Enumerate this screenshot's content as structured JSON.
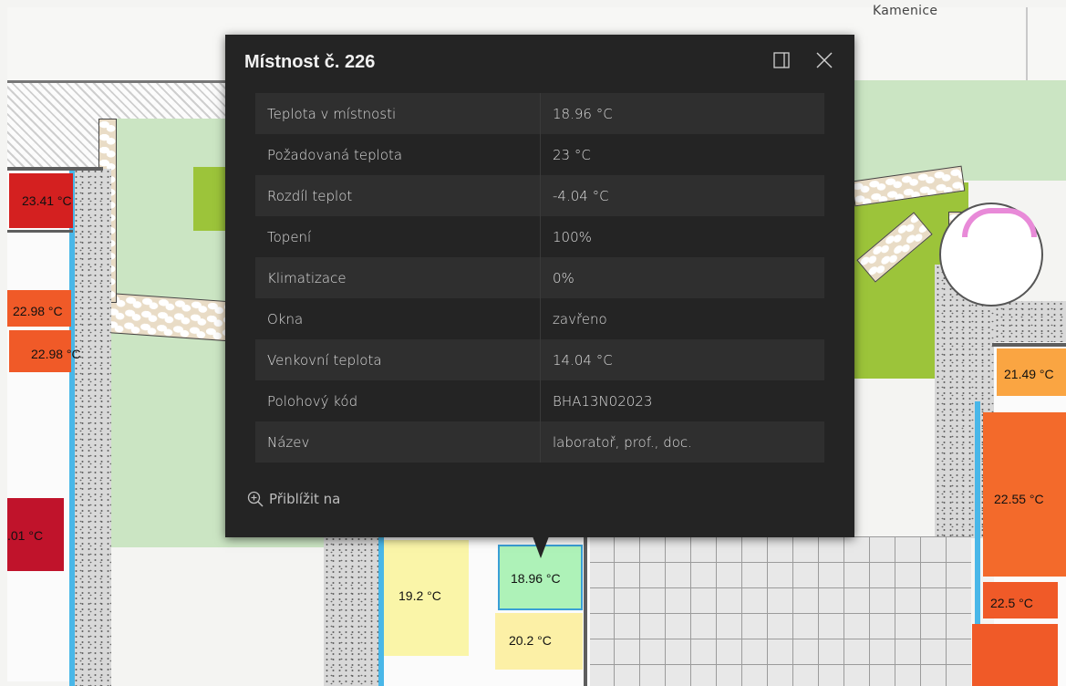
{
  "map": {
    "street_label": "Kamenice",
    "room_temperatures": [
      {
        "id": "r1",
        "label": "23.41 °C",
        "color": "#d42020"
      },
      {
        "id": "r2",
        "label": "22.98 °C",
        "color": "#f05a28"
      },
      {
        "id": "r3",
        "label": "22.98 °C",
        "color": "#f05a28"
      },
      {
        "id": "r4",
        "label": ".01 °C",
        "color": "#c0132b"
      },
      {
        "id": "r5",
        "label": "19.2 °C",
        "color": "#faf5a8"
      },
      {
        "id": "r6",
        "label": "18.96 °C",
        "color": "#aef2b8"
      },
      {
        "id": "r7",
        "label": "20.2 °C",
        "color": "#fcf0a6"
      },
      {
        "id": "r8",
        "label": "21.49 °C",
        "color": "#faa542"
      },
      {
        "id": "r9",
        "label": "22.55 °C",
        "color": "#f36a2b"
      },
      {
        "id": "r10",
        "label": "22.5 °C",
        "color": "#f05a28"
      }
    ]
  },
  "popup": {
    "title": "Místnost č. 226",
    "dock_icon": "dock-side-icon",
    "close_icon": "close-icon",
    "attributes": [
      {
        "key": "Teplota v místnosti",
        "value": "18.96 °C"
      },
      {
        "key": "Požadovaná teplota",
        "value": "23 °C"
      },
      {
        "key": "Rozdíl teplot",
        "value": "-4.04 °C"
      },
      {
        "key": "Topení",
        "value": "100%"
      },
      {
        "key": "Klimatizace",
        "value": "0%"
      },
      {
        "key": "Okna",
        "value": "zavřeno"
      },
      {
        "key": "Venkovní teplota",
        "value": "14.04 °C"
      },
      {
        "key": "Polohový kód",
        "value": "BHA13N02023"
      },
      {
        "key": "Název",
        "value": "laboratoř, prof., doc."
      }
    ],
    "zoom_label": "Přiblížit na",
    "zoom_icon": "zoom-in-icon"
  }
}
